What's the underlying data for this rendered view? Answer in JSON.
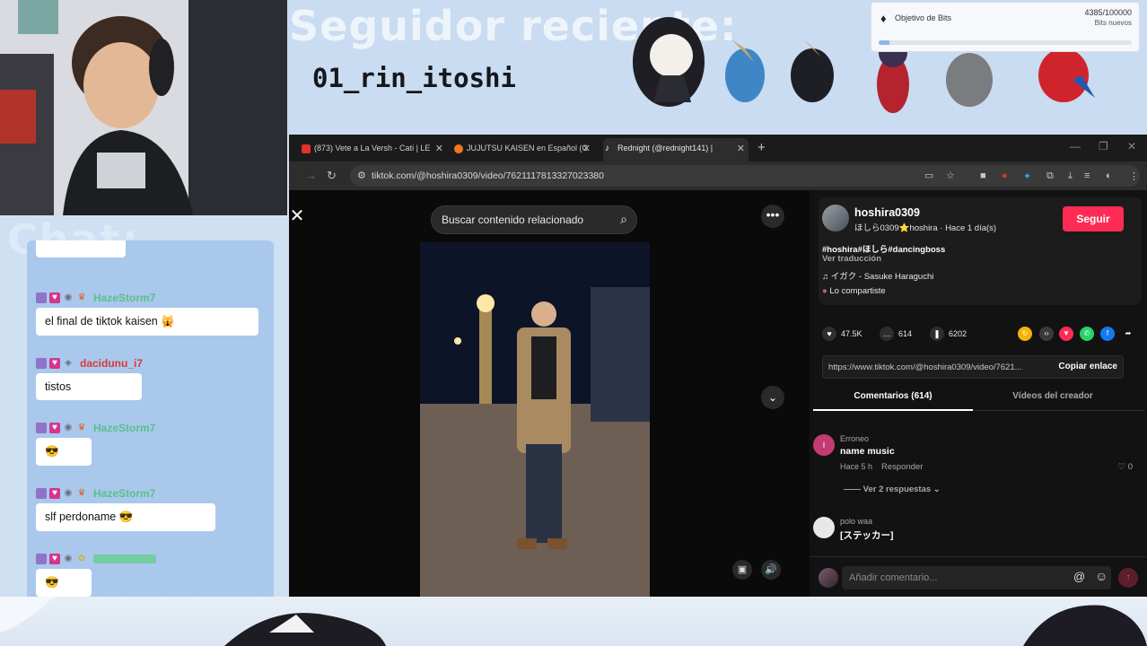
{
  "overlay": {
    "follower_title": "Seguidor reciente:",
    "follower_name": "01_rin_itoshi",
    "chat_heading": "Chat:",
    "bits": {
      "label": "Objetivo de Bits",
      "count": "4385/100000",
      "sub": "Bits nuevos",
      "progress": 0.044
    }
  },
  "chat": {
    "messages": [
      {
        "user": "HazeStorm7",
        "color": "#5bbf8a",
        "text": "el final de tiktok kaisen 🙀"
      },
      {
        "user": "dacidunu_i7",
        "color": "#d93a3a",
        "text": "tistos"
      },
      {
        "user": "HazeStorm7",
        "color": "#5bbf8a",
        "text": "😎"
      },
      {
        "user": "HazeStorm7",
        "color": "#5bbf8a",
        "text": "slf perdoname 😎"
      },
      {
        "user": "",
        "color": "#3fcf5a",
        "text": "😎"
      }
    ]
  },
  "browser": {
    "tabs": [
      {
        "title": "(873) Vete a La Versh - Cati | LE",
        "favicon": "#e0322b"
      },
      {
        "title": "JUJUTSU KAISEN en Español (C",
        "favicon": "#f47521"
      },
      {
        "title": "Rednight (@rednight141) |",
        "favicon": "#ffffff"
      }
    ],
    "new_tab": "+",
    "url": "tiktok.com/@hoshira0309/video/7621117813327023380"
  },
  "tiktok": {
    "search_placeholder": "Buscar contenido relacionado",
    "author": {
      "username": "hoshira0309",
      "subtitle": "ほしら0309⭐hoshira · Hace 1 día(s)",
      "follow_label": "Seguir"
    },
    "description": "#hoshira#ほしら#dancingboss",
    "translate": "Ver traducción",
    "music": "イガク - Sasuke Haraguchi",
    "shared": "Lo compartiste",
    "stats": {
      "likes": "47.5K",
      "comments": "614",
      "saves": "6202"
    },
    "link": {
      "url": "https://www.tiktok.com/@hoshira0309/video/7621...",
      "copy_label": "Copiar enlace"
    },
    "tabs": {
      "comments": "Comentarios (614)",
      "creator_videos": "Vídeos del creador"
    },
    "comments": [
      {
        "avatar_letter": "I",
        "user": "Erroneo",
        "text": "name music",
        "meta": "Hace 5 h",
        "reply": "Responder",
        "likes": "0",
        "more": "Ver 2 respuestas"
      },
      {
        "user": "polo waa",
        "text": "[ステッカー]"
      }
    ],
    "comment_input": {
      "placeholder": "Añadir comentario..."
    }
  },
  "colors": {
    "tiktok_red": "#fe2c55",
    "chat_panel": "#a9c8ec"
  }
}
